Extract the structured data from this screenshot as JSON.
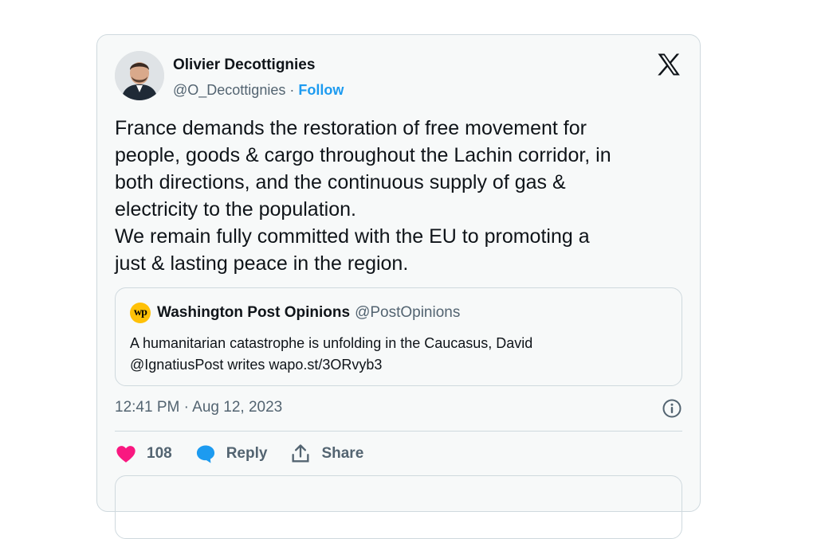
{
  "tweet": {
    "author_name": "Olivier Decottignies",
    "author_handle": "@O_Decottignies",
    "separator": " · ",
    "follow_label": "Follow",
    "text": "France demands the restoration of free movement for\npeople, goods & cargo throughout the Lachin corridor, in\nboth directions, and the continuous supply of gas &\nelectricity to the population.\nWe remain fully committed with the EU to promoting a\njust & lasting peace in the region.",
    "timestamp": "12:41 PM · Aug 12, 2023",
    "likes": "108",
    "reply_label": "Reply",
    "share_label": "Share"
  },
  "quote": {
    "logo_text": "wp",
    "name": "Washington Post Opinions",
    "handle": "@PostOpinions",
    "text": "A humanitarian catastrophe is unfolding in the Caucasus, David\n@IgnatiusPost writes wapo.st/3ORvyb3"
  },
  "colors": {
    "accent": "#1d9bf0",
    "like": "#f91880",
    "secondary_text": "#536471",
    "border": "#cfd9de",
    "wp_logo": "#ffc107"
  },
  "icons": {
    "brand": "x-logo-icon",
    "info": "info-icon",
    "like": "heart-icon",
    "reply": "speech-bubble-icon",
    "share": "share-upload-icon"
  }
}
